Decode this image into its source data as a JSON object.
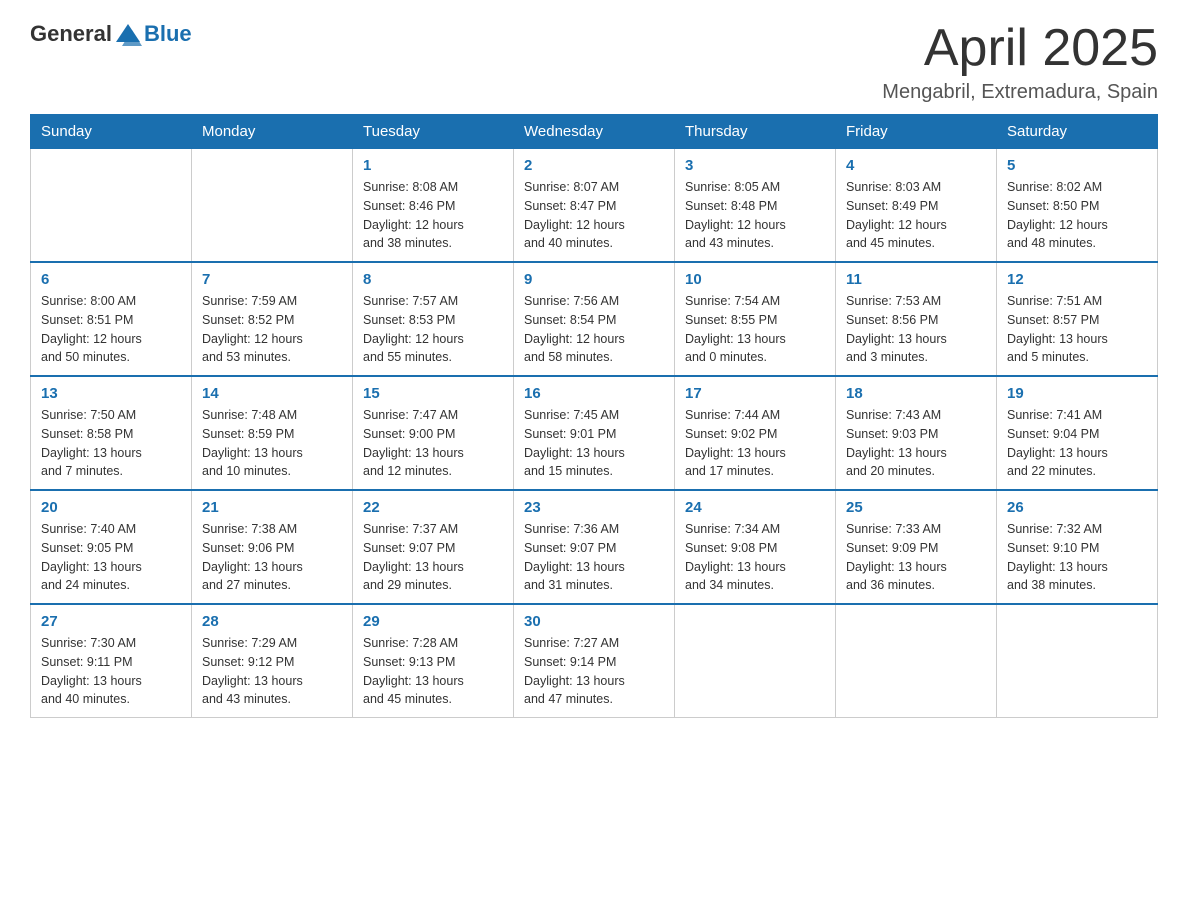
{
  "header": {
    "logo": {
      "general": "General",
      "blue": "Blue"
    },
    "title": "April 2025",
    "location": "Mengabril, Extremadura, Spain"
  },
  "weekdays": [
    "Sunday",
    "Monday",
    "Tuesday",
    "Wednesday",
    "Thursday",
    "Friday",
    "Saturday"
  ],
  "weeks": [
    [
      {
        "day": "",
        "info": ""
      },
      {
        "day": "",
        "info": ""
      },
      {
        "day": "1",
        "info": "Sunrise: 8:08 AM\nSunset: 8:46 PM\nDaylight: 12 hours\nand 38 minutes."
      },
      {
        "day": "2",
        "info": "Sunrise: 8:07 AM\nSunset: 8:47 PM\nDaylight: 12 hours\nand 40 minutes."
      },
      {
        "day": "3",
        "info": "Sunrise: 8:05 AM\nSunset: 8:48 PM\nDaylight: 12 hours\nand 43 minutes."
      },
      {
        "day": "4",
        "info": "Sunrise: 8:03 AM\nSunset: 8:49 PM\nDaylight: 12 hours\nand 45 minutes."
      },
      {
        "day": "5",
        "info": "Sunrise: 8:02 AM\nSunset: 8:50 PM\nDaylight: 12 hours\nand 48 minutes."
      }
    ],
    [
      {
        "day": "6",
        "info": "Sunrise: 8:00 AM\nSunset: 8:51 PM\nDaylight: 12 hours\nand 50 minutes."
      },
      {
        "day": "7",
        "info": "Sunrise: 7:59 AM\nSunset: 8:52 PM\nDaylight: 12 hours\nand 53 minutes."
      },
      {
        "day": "8",
        "info": "Sunrise: 7:57 AM\nSunset: 8:53 PM\nDaylight: 12 hours\nand 55 minutes."
      },
      {
        "day": "9",
        "info": "Sunrise: 7:56 AM\nSunset: 8:54 PM\nDaylight: 12 hours\nand 58 minutes."
      },
      {
        "day": "10",
        "info": "Sunrise: 7:54 AM\nSunset: 8:55 PM\nDaylight: 13 hours\nand 0 minutes."
      },
      {
        "day": "11",
        "info": "Sunrise: 7:53 AM\nSunset: 8:56 PM\nDaylight: 13 hours\nand 3 minutes."
      },
      {
        "day": "12",
        "info": "Sunrise: 7:51 AM\nSunset: 8:57 PM\nDaylight: 13 hours\nand 5 minutes."
      }
    ],
    [
      {
        "day": "13",
        "info": "Sunrise: 7:50 AM\nSunset: 8:58 PM\nDaylight: 13 hours\nand 7 minutes."
      },
      {
        "day": "14",
        "info": "Sunrise: 7:48 AM\nSunset: 8:59 PM\nDaylight: 13 hours\nand 10 minutes."
      },
      {
        "day": "15",
        "info": "Sunrise: 7:47 AM\nSunset: 9:00 PM\nDaylight: 13 hours\nand 12 minutes."
      },
      {
        "day": "16",
        "info": "Sunrise: 7:45 AM\nSunset: 9:01 PM\nDaylight: 13 hours\nand 15 minutes."
      },
      {
        "day": "17",
        "info": "Sunrise: 7:44 AM\nSunset: 9:02 PM\nDaylight: 13 hours\nand 17 minutes."
      },
      {
        "day": "18",
        "info": "Sunrise: 7:43 AM\nSunset: 9:03 PM\nDaylight: 13 hours\nand 20 minutes."
      },
      {
        "day": "19",
        "info": "Sunrise: 7:41 AM\nSunset: 9:04 PM\nDaylight: 13 hours\nand 22 minutes."
      }
    ],
    [
      {
        "day": "20",
        "info": "Sunrise: 7:40 AM\nSunset: 9:05 PM\nDaylight: 13 hours\nand 24 minutes."
      },
      {
        "day": "21",
        "info": "Sunrise: 7:38 AM\nSunset: 9:06 PM\nDaylight: 13 hours\nand 27 minutes."
      },
      {
        "day": "22",
        "info": "Sunrise: 7:37 AM\nSunset: 9:07 PM\nDaylight: 13 hours\nand 29 minutes."
      },
      {
        "day": "23",
        "info": "Sunrise: 7:36 AM\nSunset: 9:07 PM\nDaylight: 13 hours\nand 31 minutes."
      },
      {
        "day": "24",
        "info": "Sunrise: 7:34 AM\nSunset: 9:08 PM\nDaylight: 13 hours\nand 34 minutes."
      },
      {
        "day": "25",
        "info": "Sunrise: 7:33 AM\nSunset: 9:09 PM\nDaylight: 13 hours\nand 36 minutes."
      },
      {
        "day": "26",
        "info": "Sunrise: 7:32 AM\nSunset: 9:10 PM\nDaylight: 13 hours\nand 38 minutes."
      }
    ],
    [
      {
        "day": "27",
        "info": "Sunrise: 7:30 AM\nSunset: 9:11 PM\nDaylight: 13 hours\nand 40 minutes."
      },
      {
        "day": "28",
        "info": "Sunrise: 7:29 AM\nSunset: 9:12 PM\nDaylight: 13 hours\nand 43 minutes."
      },
      {
        "day": "29",
        "info": "Sunrise: 7:28 AM\nSunset: 9:13 PM\nDaylight: 13 hours\nand 45 minutes."
      },
      {
        "day": "30",
        "info": "Sunrise: 7:27 AM\nSunset: 9:14 PM\nDaylight: 13 hours\nand 47 minutes."
      },
      {
        "day": "",
        "info": ""
      },
      {
        "day": "",
        "info": ""
      },
      {
        "day": "",
        "info": ""
      }
    ]
  ]
}
